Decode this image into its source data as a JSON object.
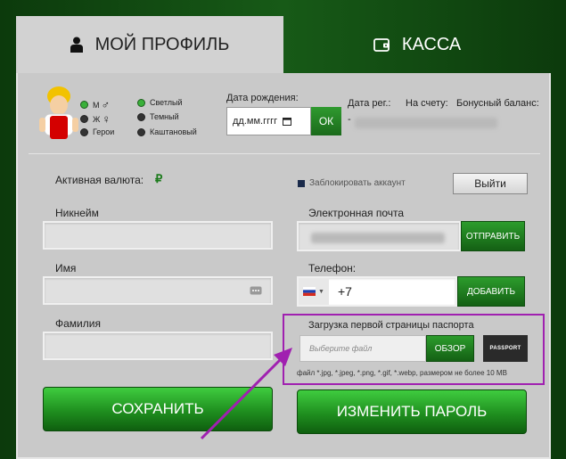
{
  "tabs": {
    "profile_label": "МОЙ ПРОФИЛЬ",
    "kassa_label": "КАССА"
  },
  "gender": {
    "options": [
      "М",
      "Ж",
      "Герои"
    ],
    "symbols": [
      "♂",
      "♀"
    ],
    "selected": "М"
  },
  "theme": {
    "options": [
      "Светлый",
      "Темный",
      "Каштановый"
    ],
    "selected": "Светлый"
  },
  "birthdate": {
    "label": "Дата рождения:",
    "placeholder": "дд.мм.гггг",
    "ok_label": "ОК"
  },
  "account_info": {
    "reg_date_label": "Дата рег.:",
    "reg_date_value": "-",
    "balance_label": "На счету:",
    "bonus_label": "Бонусный баланс:"
  },
  "currency": {
    "label": "Активная валюта:",
    "symbol": "₽"
  },
  "block_account_label": "Заблокировать аккаунт",
  "logout_label": "Выйти",
  "fields": {
    "nickname_label": "Никнейм",
    "name_label": "Имя",
    "surname_label": "Фамилия",
    "email_label": "Электронная почта",
    "email_send_label": "ОТПРАВИТЬ",
    "phone_label": "Телефон:",
    "phone_prefix": "+7",
    "phone_add_label": "ДОБАВИТЬ"
  },
  "passport": {
    "label": "Загрузка первой страницы паспорта",
    "placeholder": "Выберите файл",
    "browse_label": "ОБЗОР",
    "icon_text": "PASSPORT",
    "hint": "файл *.jpg, *.jpeg, *.png, *.gif, *.webp, размером не более 10 MB"
  },
  "buttons": {
    "save_label": "СОХРАНИТЬ",
    "change_password_label": "ИЗМЕНИТЬ ПАРОЛЬ"
  },
  "colors": {
    "accent_green": "#1f8f1f",
    "highlight_purple": "#a020b0",
    "tab_active_bg": "#d2d2d2"
  }
}
